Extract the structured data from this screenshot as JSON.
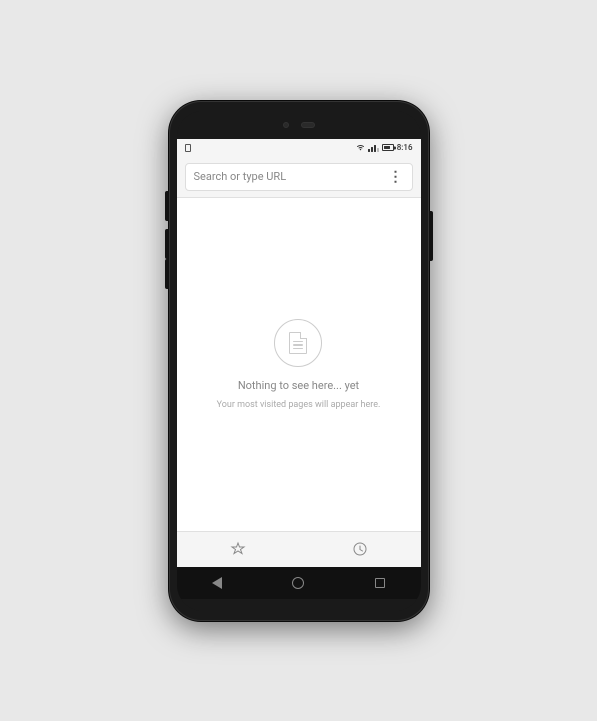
{
  "phone": {
    "status_bar": {
      "time": "8:16",
      "notification_icon": "notification",
      "wifi_signal": "wifi",
      "cellular_signal": "signal",
      "battery": "battery"
    },
    "address_bar": {
      "placeholder": "Search or type URL",
      "more_label": "⋮"
    },
    "browser_content": {
      "empty_icon": "document",
      "empty_title": "Nothing to see here... yet",
      "empty_subtitle": "Your most visited pages will appear here."
    },
    "browser_nav": {
      "bookmarks_label": "☆",
      "history_label": "🕐"
    },
    "system_nav": {
      "back_label": "back",
      "home_label": "home",
      "recents_label": "recents"
    }
  }
}
